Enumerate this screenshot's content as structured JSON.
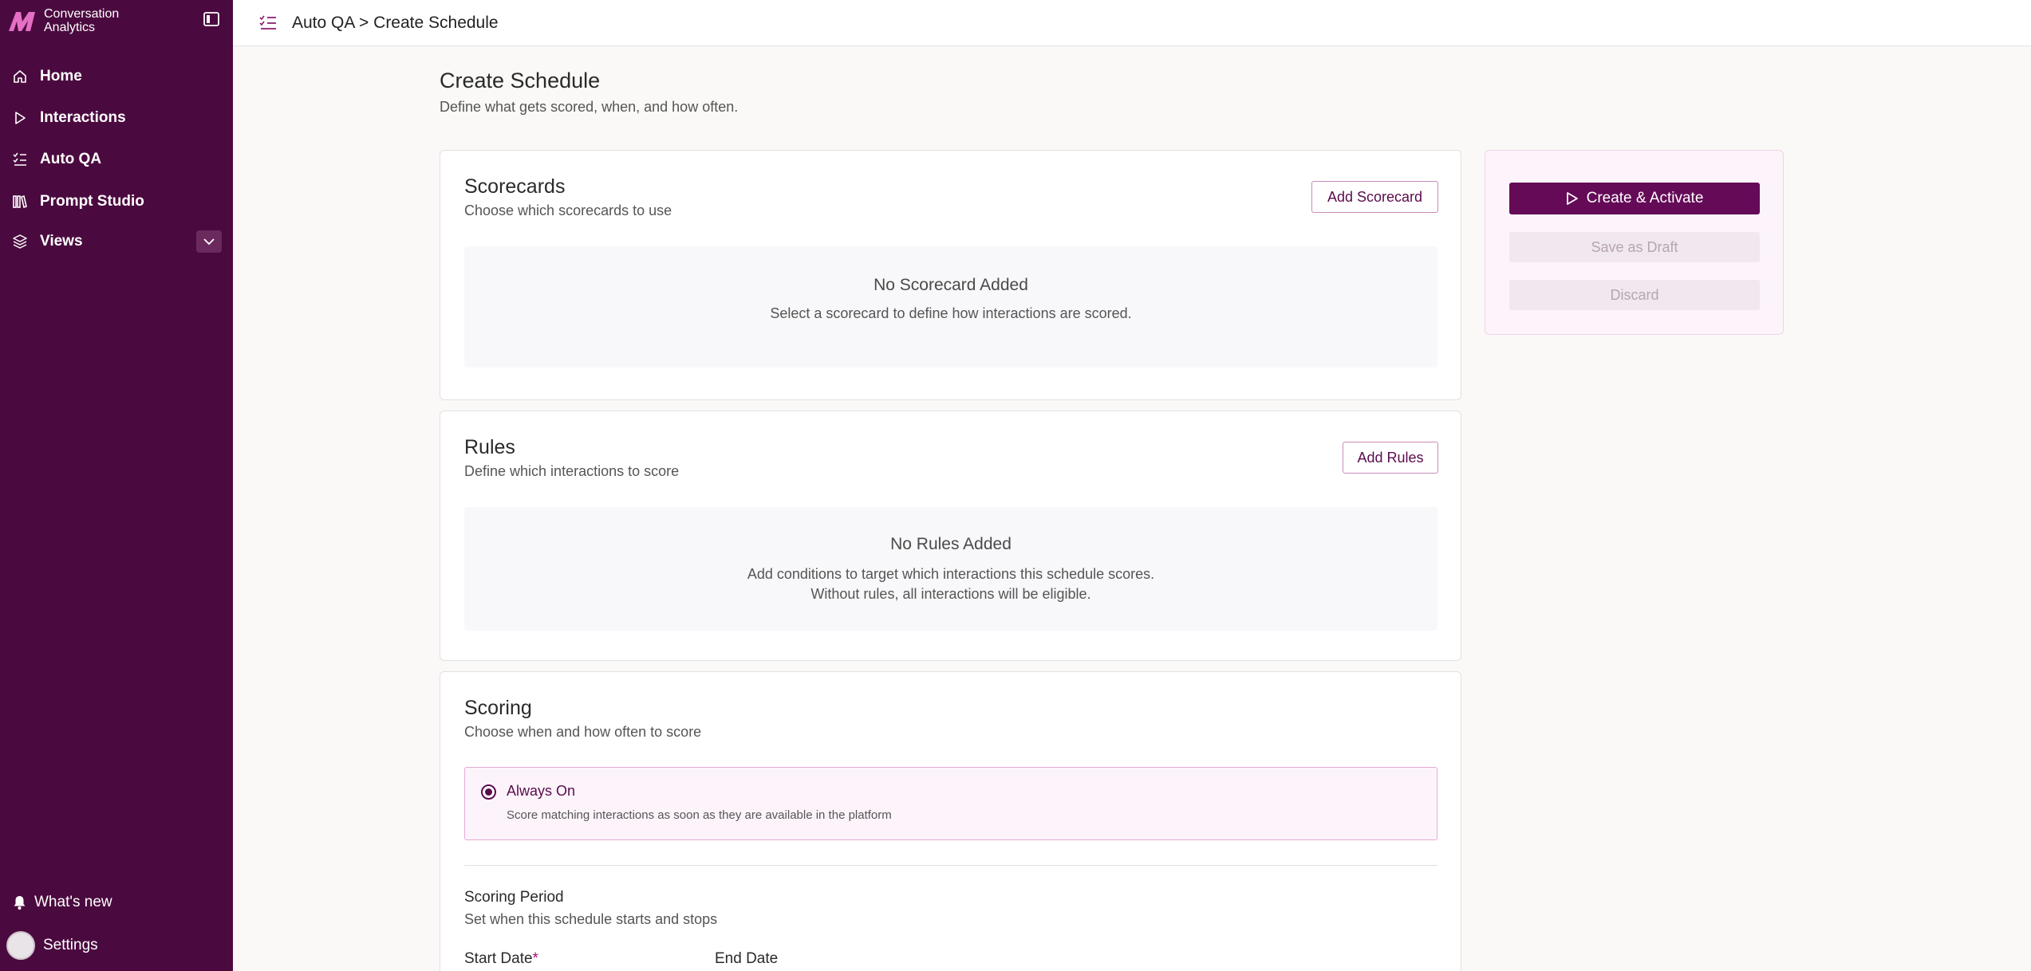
{
  "app": {
    "brand_line1": "Conversation",
    "brand_line2": "Analytics",
    "accent_color": "#640a57",
    "sidebar_color": "#4b0a3f"
  },
  "sidebar": {
    "items": [
      {
        "label": "Home",
        "icon": "home-icon"
      },
      {
        "label": "Interactions",
        "icon": "play-icon"
      },
      {
        "label": "Auto QA",
        "icon": "checklist-icon"
      },
      {
        "label": "Prompt Studio",
        "icon": "library-icon"
      },
      {
        "label": "Views",
        "icon": "layers-icon"
      }
    ],
    "footer": {
      "whats_new": "What's new",
      "settings": "Settings"
    }
  },
  "topbar": {
    "breadcrumb": "Auto QA > Create Schedule"
  },
  "page": {
    "title": "Create Schedule",
    "subtitle": "Define what gets scored, when, and how often."
  },
  "scorecards": {
    "title": "Scorecards",
    "subtitle": "Choose which scorecards to use",
    "button": "Add Scorecard",
    "empty_title": "No Scorecard Added",
    "empty_desc": "Select a scorecard to define how interactions are scored."
  },
  "rules": {
    "title": "Rules",
    "subtitle": "Define which interactions to score",
    "button": "Add Rules",
    "empty_title": "No Rules Added",
    "empty_desc_1": "Add conditions to target which interactions this schedule scores.",
    "empty_desc_2": "Without rules, all interactions will be eligible."
  },
  "scoring": {
    "title": "Scoring",
    "subtitle": "Choose when and how often to score",
    "option_label": "Always On",
    "option_desc": "Score matching interactions as soon as they are available in the platform",
    "period_title": "Scoring Period",
    "period_sub": "Set when this schedule starts and stops",
    "start_label": "Start Date",
    "required_mark": "*",
    "end_label": "End Date"
  },
  "actions": {
    "primary": "Create & Activate",
    "draft": "Save as Draft",
    "discard": "Discard"
  }
}
